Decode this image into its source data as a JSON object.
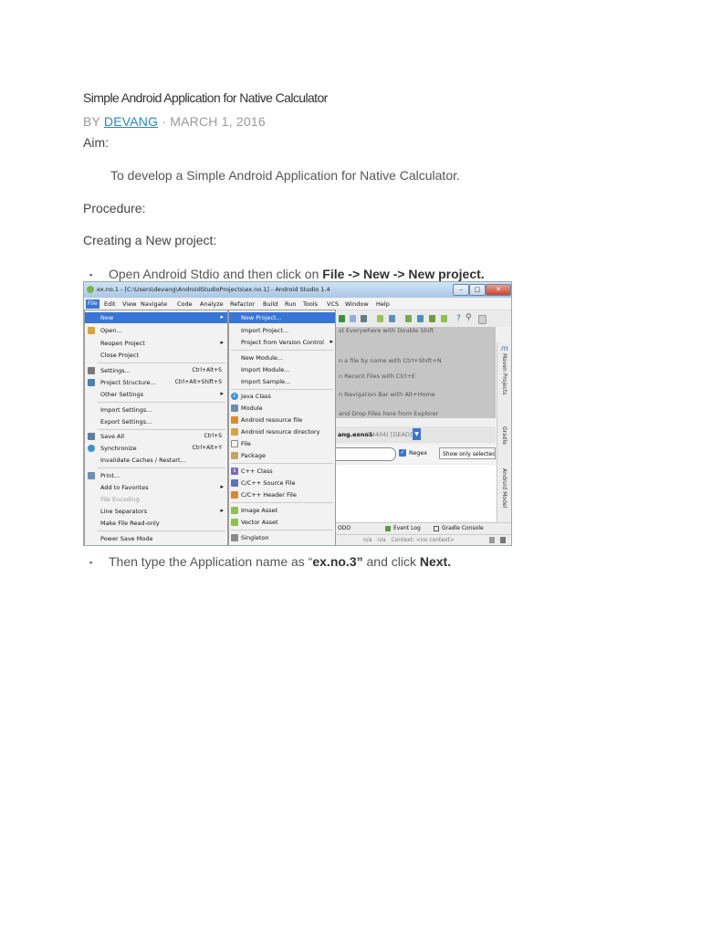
{
  "article": {
    "title": "Simple Android Application for Native Calculator",
    "by": "BY",
    "author": "DEVANG",
    "date_sep": "·",
    "date": "MARCH 1, 2016",
    "aim_label": "Aim:",
    "aim_text": "To develop a Simple Android Application for Native Calculator.",
    "procedure_label": "Procedure:",
    "creating_label": "Creating a New project:",
    "bullet": "▪",
    "step1_pre": "Open Android Stdio and then click on ",
    "step1_bold": "File -> New -> New project.",
    "step2_pre": "Then type the Application name as “",
    "step2_bold1": "ex.no.3”",
    "step2_mid": " and click ",
    "step2_bold2": "Next."
  },
  "screenshot": {
    "window_title": "ex.no.1 - [C:\\Users\\devang\\AndroidStudioProjects\\ex.no.1] - Android Studio 1.4",
    "window_buttons": [
      "–",
      "□",
      "✕"
    ],
    "menubar": [
      "File",
      "Edit",
      "View",
      "Navigate",
      "Code",
      "Analyze",
      "Refactor",
      "Build",
      "Run",
      "Tools",
      "VCS",
      "Window",
      "Help"
    ],
    "file_menu": [
      {
        "label": "New",
        "shortcut": "",
        "arrow": "▸"
      },
      {
        "label": "Open...",
        "shortcut": "",
        "arrow": ""
      },
      {
        "label": "Reopen Project",
        "shortcut": "",
        "arrow": "▸"
      },
      {
        "label": "Close Project",
        "shortcut": "",
        "arrow": ""
      },
      {
        "label": "Settings...",
        "shortcut": "Ctrl+Alt+S",
        "arrow": ""
      },
      {
        "label": "Project Structure...",
        "shortcut": "Ctrl+Alt+Shift+S",
        "arrow": ""
      },
      {
        "label": "Other Settings",
        "shortcut": "",
        "arrow": "▸"
      },
      {
        "label": "Import Settings...",
        "shortcut": "",
        "arrow": ""
      },
      {
        "label": "Export Settings...",
        "shortcut": "",
        "arrow": ""
      },
      {
        "label": "Save All",
        "shortcut": "Ctrl+S",
        "arrow": ""
      },
      {
        "label": "Synchronize",
        "shortcut": "Ctrl+Alt+Y",
        "arrow": ""
      },
      {
        "label": "Invalidate Caches / Restart...",
        "shortcut": "",
        "arrow": ""
      },
      {
        "label": "Print...",
        "shortcut": "",
        "arrow": ""
      },
      {
        "label": "Add to Favorites",
        "shortcut": "",
        "arrow": "▸"
      },
      {
        "label": "File Encoding",
        "shortcut": "",
        "arrow": ""
      },
      {
        "label": "Line Separators",
        "shortcut": "",
        "arrow": "▸"
      },
      {
        "label": "Make File Read-only",
        "shortcut": "",
        "arrow": ""
      },
      {
        "label": "Power Save Mode",
        "shortcut": "",
        "arrow": ""
      }
    ],
    "new_menu": [
      {
        "label": "New Project...",
        "arrow": ""
      },
      {
        "label": "Import Project...",
        "arrow": ""
      },
      {
        "label": "Project from Version Control",
        "arrow": "▸"
      },
      {
        "label": "New Module...",
        "arrow": ""
      },
      {
        "label": "Import Module...",
        "arrow": ""
      },
      {
        "label": "Import Sample...",
        "arrow": ""
      },
      {
        "label": "Java Class",
        "arrow": ""
      },
      {
        "label": "Module",
        "arrow": ""
      },
      {
        "label": "Android resource file",
        "arrow": ""
      },
      {
        "label": "Android resource directory",
        "arrow": ""
      },
      {
        "label": "File",
        "arrow": ""
      },
      {
        "label": "Package",
        "arrow": ""
      },
      {
        "label": "C++ Class",
        "arrow": ""
      },
      {
        "label": "C/C++ Source File",
        "arrow": ""
      },
      {
        "label": "C/C++ Header File",
        "arrow": ""
      },
      {
        "label": "Image Asset",
        "arrow": ""
      },
      {
        "label": "Vector Asset",
        "arrow": ""
      },
      {
        "label": "Singleton",
        "arrow": ""
      }
    ],
    "ghost_lines": [
      "st Everywhere with Double Shift",
      "n a file by name with Ctrl+Shift+N",
      "n Recent Files with Ctrl+E",
      "n Navigation Bar with Alt+Home",
      "and Drop Files here from Explorer"
    ],
    "run_target": "ang.exno1",
    "run_target_suffix": "(14404) [DEAD]",
    "regex_label": "Regex",
    "show_only_selected": "Show only selected a",
    "side_labels": [
      "Maven Projects",
      "Gradle",
      "Android Model"
    ],
    "side_mark": "m",
    "status_todo": "ODO",
    "status_event_log": "Event Log",
    "status_gradle_console": "Gradle Console",
    "status_bottom": "n/a   n/a   Context: <no context>"
  }
}
